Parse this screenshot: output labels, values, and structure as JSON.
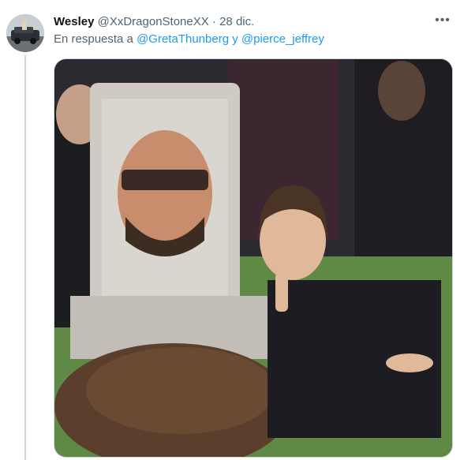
{
  "tweet": {
    "author_name": "Wesley",
    "handle": "@XxDragonStoneXX",
    "separator": "·",
    "date": "28 dic.",
    "reply_prefix": "En respuesta a",
    "reply_to": [
      "@GretaThunberg",
      "@pierce_jeffrey"
    ],
    "reply_joiner": "y",
    "more_icon": "more-horizontal-icon",
    "media_description_icon": "meme-photo"
  },
  "colors": {
    "link": "#1d9bf0",
    "secondary_text": "#536471",
    "thread_line": "#cfd9de"
  }
}
